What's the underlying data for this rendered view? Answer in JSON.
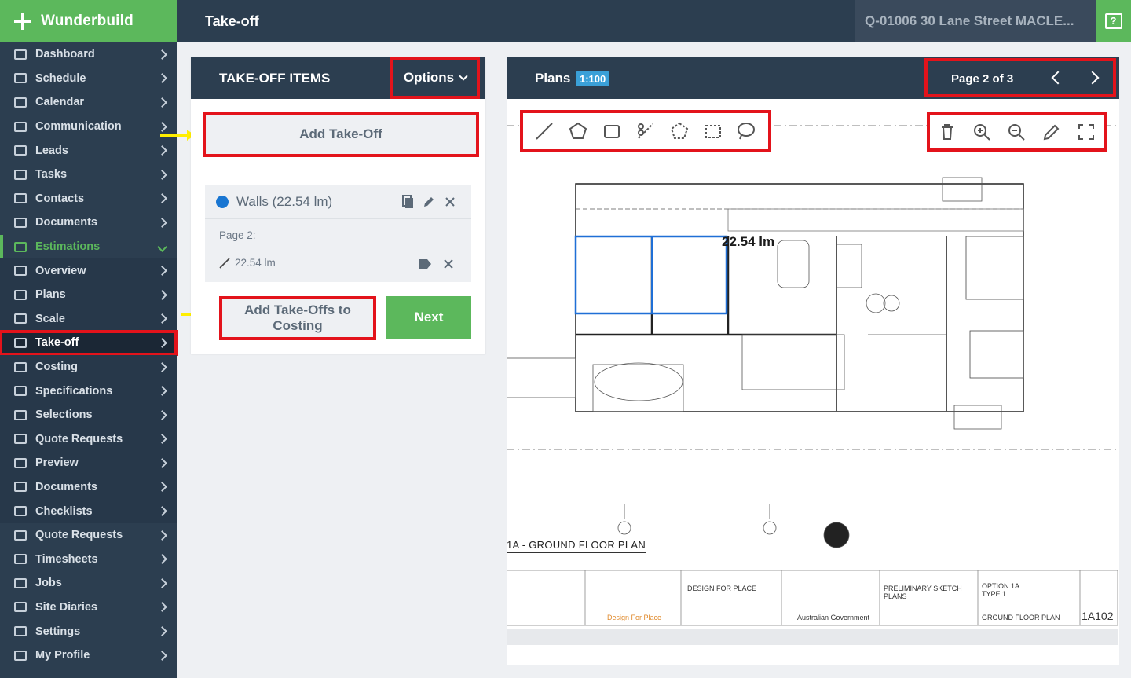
{
  "brand": {
    "name": "Wunderbuild"
  },
  "header": {
    "title": "Take-off",
    "quote": "Q-01006 30 Lane Street MACLE..."
  },
  "sidebar": {
    "items": [
      {
        "label": "Dashboard"
      },
      {
        "label": "Schedule"
      },
      {
        "label": "Calendar"
      },
      {
        "label": "Communication"
      },
      {
        "label": "Leads"
      },
      {
        "label": "Tasks"
      },
      {
        "label": "Contacts"
      },
      {
        "label": "Documents"
      },
      {
        "label": "Estimations"
      },
      {
        "label": "Overview"
      },
      {
        "label": "Plans"
      },
      {
        "label": "Scale"
      },
      {
        "label": "Take-off"
      },
      {
        "label": "Costing"
      },
      {
        "label": "Specifications"
      },
      {
        "label": "Selections"
      },
      {
        "label": "Quote Requests"
      },
      {
        "label": "Preview"
      },
      {
        "label": "Documents"
      },
      {
        "label": "Checklists"
      },
      {
        "label": "Quote Requests"
      },
      {
        "label": "Timesheets"
      },
      {
        "label": "Jobs"
      },
      {
        "label": "Site Diaries"
      },
      {
        "label": "Settings"
      },
      {
        "label": "My Profile"
      }
    ]
  },
  "takeoff": {
    "title": "TAKE-OFF ITEMS",
    "options_label": "Options",
    "add_label": "Add Take-Off",
    "item": {
      "name": "Walls (22.54 lm)",
      "page": "Page 2:",
      "measure": "22.54 lm"
    },
    "add_costing_label": "Add Take-Offs to Costing",
    "next_label": "Next"
  },
  "plans": {
    "title": "Plans",
    "scale": "1:100",
    "page_label": "Page 2 of 3",
    "measure_label": "22.54 lm",
    "plan_title": "1A - GROUND FLOOR PLAN",
    "titleblock": {
      "design": "Design For Place",
      "project_label": "DESIGN FOR PLACE",
      "govt": "Australian Government",
      "stage": "PRELIMINARY SKETCH PLANS",
      "option": "OPTION 1A TYPE 1",
      "sheet": "GROUND FLOOR PLAN",
      "number": "1A102"
    }
  },
  "colors": {
    "sidebar": "#2c3e50",
    "brand": "#5cb85c",
    "highlight": "#e3131b",
    "arrow": "#ffee00",
    "scale_badge": "#3aa0d8"
  }
}
